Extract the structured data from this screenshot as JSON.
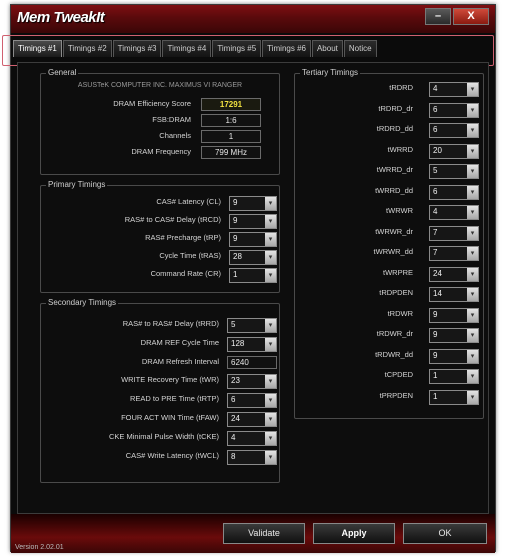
{
  "window": {
    "title": "Mem TweakIt"
  },
  "titlebar": {
    "minimize_label": "–",
    "close_label": "X"
  },
  "tabs": [
    {
      "label": "Timings #1"
    },
    {
      "label": "Timings #2"
    },
    {
      "label": "Timings #3"
    },
    {
      "label": "Timings #4"
    },
    {
      "label": "Timings #5"
    },
    {
      "label": "Timings #6"
    },
    {
      "label": "About"
    },
    {
      "label": "Notice"
    }
  ],
  "general": {
    "title": "General",
    "board": "ASUSTeK COMPUTER INC. MAXIMUS VI RANGER",
    "rows": [
      {
        "label": "DRAM Efficiency Score",
        "value": "17291"
      },
      {
        "label": "FSB:DRAM",
        "value": "1:6"
      },
      {
        "label": "Channels",
        "value": "1"
      },
      {
        "label": "DRAM Frequency",
        "value": "799 MHz"
      }
    ]
  },
  "primary": {
    "title": "Primary Timings",
    "rows": [
      {
        "label": "CAS# Latency (CL)",
        "value": "9"
      },
      {
        "label": "RAS# to CAS# Delay (tRCD)",
        "value": "9"
      },
      {
        "label": "RAS# Precharge (tRP)",
        "value": "9"
      },
      {
        "label": "Cycle Time (tRAS)",
        "value": "28"
      },
      {
        "label": "Command Rate (CR)",
        "value": "1"
      }
    ]
  },
  "secondary": {
    "title": "Secondary Timings",
    "rows": [
      {
        "label": "RAS# to RAS# Delay (tRRD)",
        "value": "5"
      },
      {
        "label": "DRAM REF Cycle Time",
        "value": "128"
      },
      {
        "label": "DRAM Refresh Interval",
        "value": "6240"
      },
      {
        "label": "WRITE Recovery Time (tWR)",
        "value": "23"
      },
      {
        "label": "READ to PRE Time (tRTP)",
        "value": "6"
      },
      {
        "label": "FOUR ACT WIN Time (tFAW)",
        "value": "24"
      },
      {
        "label": "CKE Minimal Pulse Width (tCKE)",
        "value": "4"
      },
      {
        "label": "CAS# Write Latency (tWCL)",
        "value": "8"
      }
    ]
  },
  "tertiary": {
    "title": "Tertiary Timings",
    "rows": [
      {
        "label": "tRDRD",
        "value": "4"
      },
      {
        "label": "tRDRD_dr",
        "value": "6"
      },
      {
        "label": "tRDRD_dd",
        "value": "6"
      },
      {
        "label": "tWRRD",
        "value": "20"
      },
      {
        "label": "tWRRD_dr",
        "value": "5"
      },
      {
        "label": "tWRRD_dd",
        "value": "6"
      },
      {
        "label": "tWRWR",
        "value": "4"
      },
      {
        "label": "tWRWR_dr",
        "value": "7"
      },
      {
        "label": "tWRWR_dd",
        "value": "7"
      },
      {
        "label": "tWRPRE",
        "value": "24"
      },
      {
        "label": "tRDPDEN",
        "value": "14"
      },
      {
        "label": "tRDWR",
        "value": "9"
      },
      {
        "label": "tRDWR_dr",
        "value": "9"
      },
      {
        "label": "tRDWR_dd",
        "value": "9"
      },
      {
        "label": "tCPDED",
        "value": "1"
      },
      {
        "label": "tPRPDEN",
        "value": "1"
      }
    ]
  },
  "footer": {
    "validate_label": "Validate",
    "apply_label": "Apply",
    "ok_label": "OK",
    "version": "Version 2.02.01"
  },
  "colors": {
    "titlebar": "#7e0f12",
    "footer": "#6a0b0b",
    "score": "#f0e040"
  }
}
